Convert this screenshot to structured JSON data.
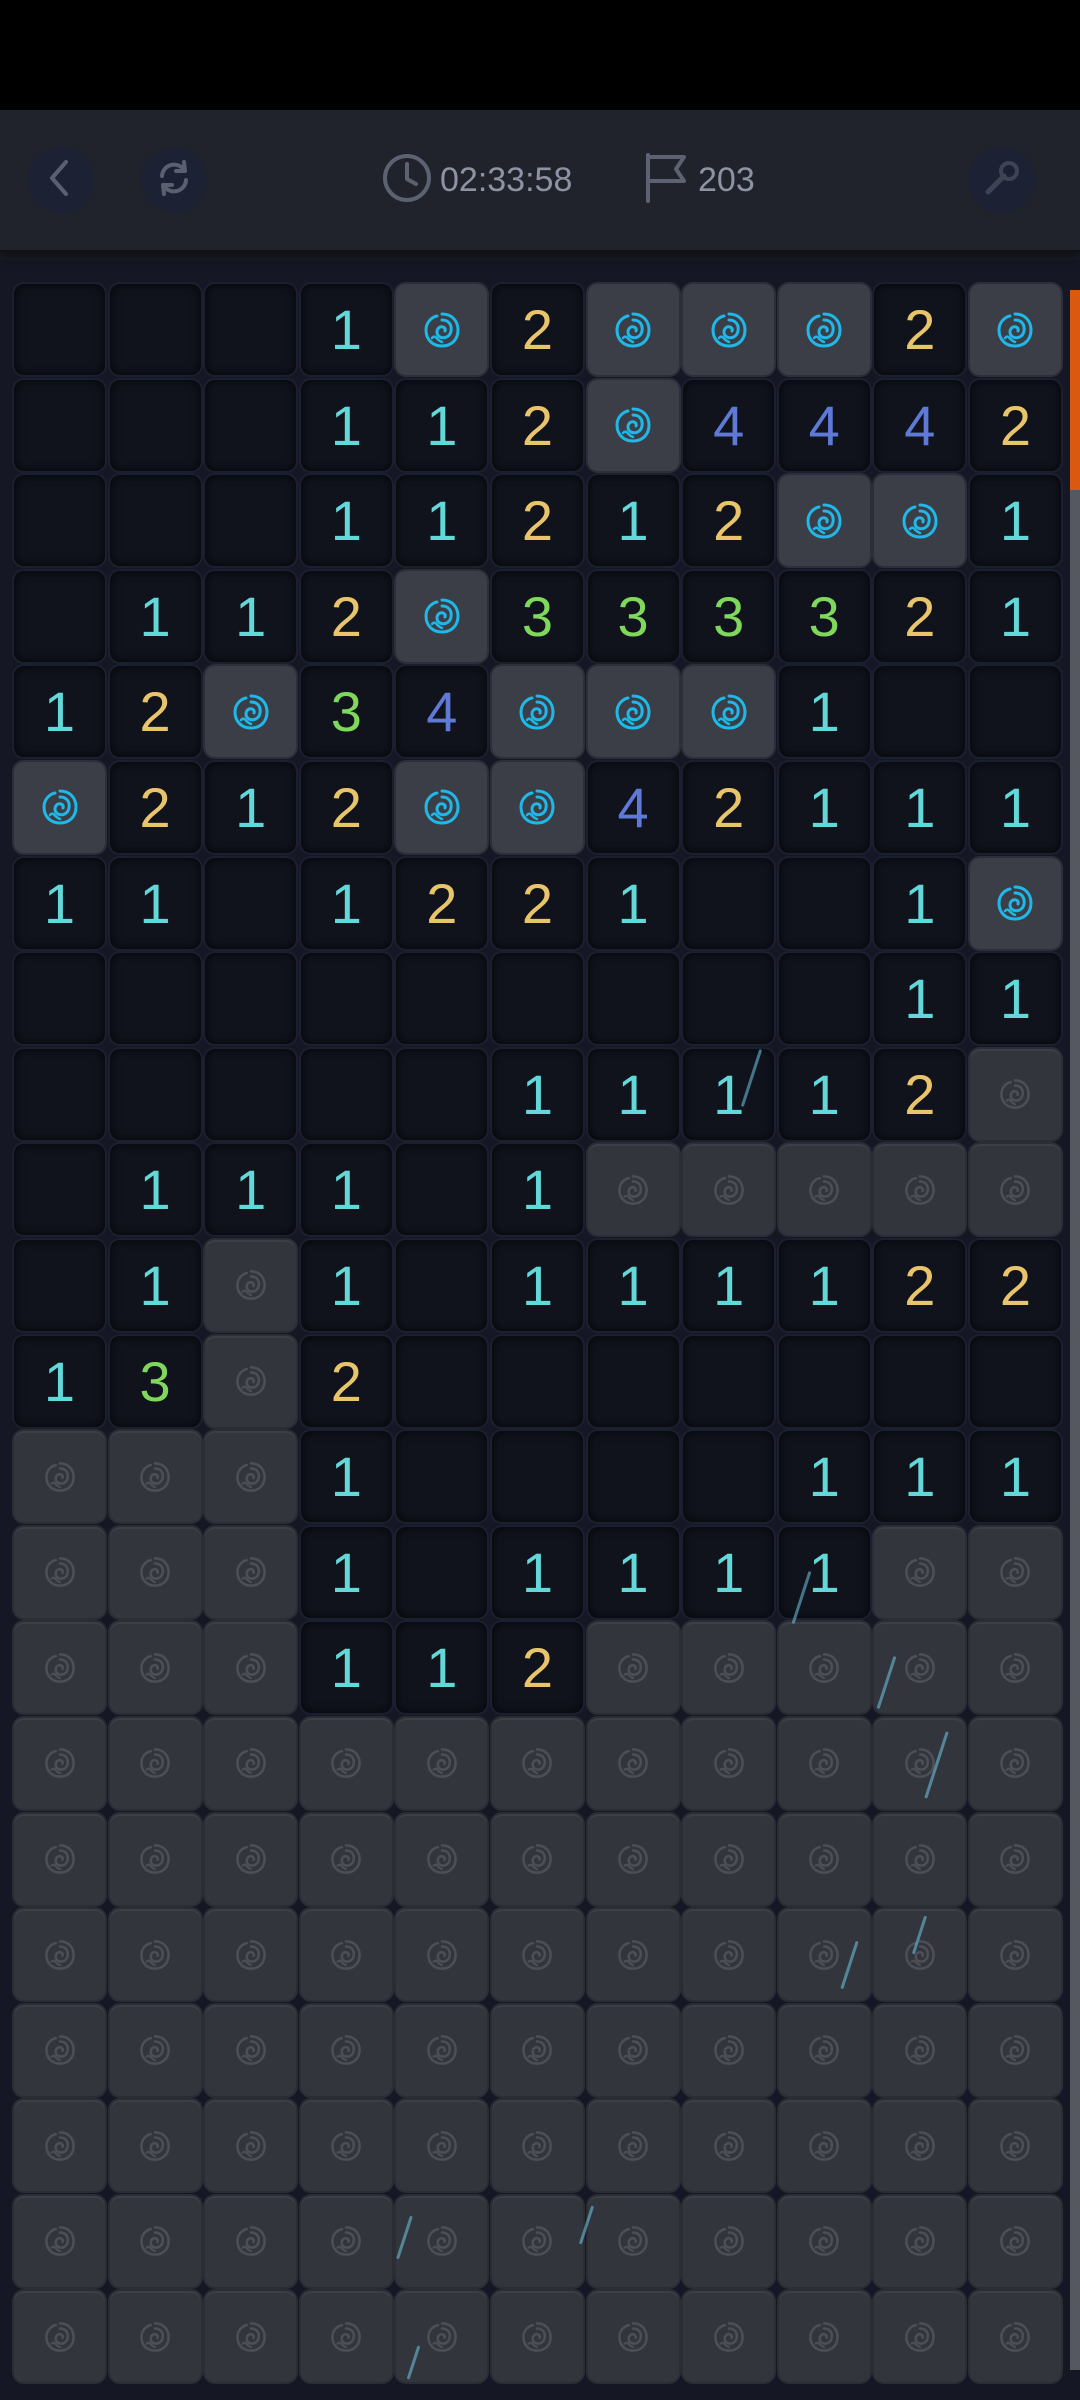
{
  "header": {
    "timer": "02:33:58",
    "flags": "203"
  },
  "icons": {
    "back": "chevron-left-icon",
    "restart": "refresh-icon",
    "timer": "clock-icon",
    "flags": "flag-icon",
    "hint": "wrench-icon",
    "mine": "rose-icon"
  },
  "colors": {
    "one": "#62d8d8",
    "two": "#e8c56a",
    "three": "#7fd85c",
    "four": "#5f79d6",
    "rose": "#1fb8e8",
    "accent": "#d8590f"
  },
  "board": {
    "cols": 11,
    "rows": [
      [
        "",
        "",
        "",
        "1",
        "M",
        "2",
        "M",
        "M",
        "M",
        "2",
        "M"
      ],
      [
        "",
        "",
        "",
        "1",
        "1",
        "2",
        "M",
        "4",
        "4",
        "4",
        "2"
      ],
      [
        "",
        "",
        "",
        "1",
        "1",
        "2",
        "1",
        "2",
        "M",
        "M",
        "1"
      ],
      [
        "",
        "1",
        "1",
        "2",
        "M",
        "3",
        "3",
        "3",
        "3",
        "2",
        "1"
      ],
      [
        "1",
        "2",
        "M",
        "3",
        "4",
        "M",
        "M",
        "M",
        "1",
        "",
        ""
      ],
      [
        "M",
        "2",
        "1",
        "2",
        "M",
        "M",
        "4",
        "2",
        "1",
        "1",
        "1"
      ],
      [
        "1",
        "1",
        "",
        "1",
        "2",
        "2",
        "1",
        "",
        "",
        "1",
        "M"
      ],
      [
        "",
        "",
        "",
        "",
        "",
        "",
        "",
        "",
        "",
        "1",
        "1"
      ],
      [
        "",
        "",
        "",
        "",
        "",
        "1",
        "1",
        "1",
        "1",
        "2",
        "C"
      ],
      [
        "",
        "1",
        "1",
        "1",
        "",
        "1",
        "C",
        "C",
        "C",
        "C",
        "C"
      ],
      [
        "",
        "1",
        "C",
        "1",
        "",
        "1",
        "1",
        "1",
        "1",
        "2",
        "2"
      ],
      [
        "1",
        "3",
        "C",
        "2",
        "",
        "",
        "",
        "",
        "",
        "",
        ""
      ],
      [
        "C",
        "C",
        "C",
        "1",
        "",
        "",
        "",
        "",
        "1",
        "1",
        "1"
      ],
      [
        "C",
        "C",
        "C",
        "1",
        "",
        "1",
        "1",
        "1",
        "1",
        "C",
        "C"
      ],
      [
        "C",
        "C",
        "C",
        "1",
        "1",
        "2",
        "C",
        "C",
        "C",
        "C",
        "C"
      ],
      [
        "C",
        "C",
        "C",
        "C",
        "C",
        "C",
        "C",
        "C",
        "C",
        "C",
        "C"
      ],
      [
        "C",
        "C",
        "C",
        "C",
        "C",
        "C",
        "C",
        "C",
        "C",
        "C",
        "C"
      ],
      [
        "C",
        "C",
        "C",
        "C",
        "C",
        "C",
        "C",
        "C",
        "C",
        "C",
        "C"
      ],
      [
        "C",
        "C",
        "C",
        "C",
        "C",
        "C",
        "C",
        "C",
        "C",
        "C",
        "C"
      ],
      [
        "C",
        "C",
        "C",
        "C",
        "C",
        "C",
        "C",
        "C",
        "C",
        "C",
        "C"
      ],
      [
        "C",
        "C",
        "C",
        "C",
        "C",
        "C",
        "C",
        "C",
        "C",
        "C",
        "C"
      ],
      [
        "C",
        "C",
        "C",
        "C",
        "C",
        "C",
        "C",
        "C",
        "C",
        "C",
        "C"
      ]
    ]
  }
}
